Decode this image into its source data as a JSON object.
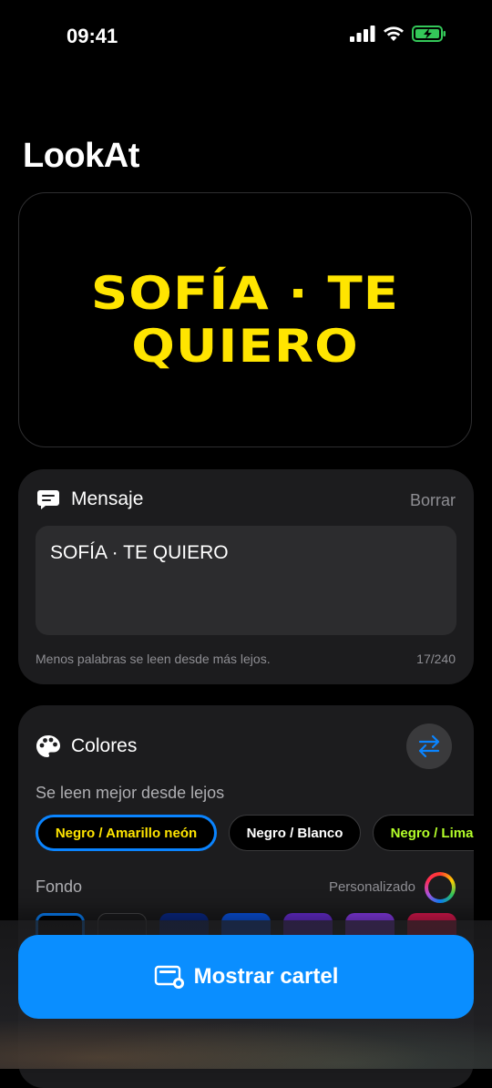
{
  "status_bar": {
    "time": "09:41"
  },
  "app": {
    "title": "LookAt"
  },
  "preview": {
    "text": "SOFÍA · TE QUIERO",
    "text_color": "#ffe500",
    "background": "#000000"
  },
  "message_card": {
    "icon": "message-icon",
    "title": "Mensaje",
    "clear_label": "Borrar",
    "value": "SOFÍA · TE QUIERO",
    "hint": "Menos palabras se leen desde más lejos.",
    "counter": "17/240"
  },
  "colors_card": {
    "icon": "palette-icon",
    "title": "Colores",
    "swap_icon": "swap-arrows-icon",
    "subtitle": "Se leen mejor desde lejos",
    "presets": [
      {
        "label": "Negro / Amarillo neón",
        "text_color": "#ffe500",
        "selected": true
      },
      {
        "label": "Negro / Blanco",
        "text_color": "#ffffff",
        "selected": false
      },
      {
        "label": "Negro / Lima",
        "text_color": "#b4ff2a",
        "selected": false
      }
    ],
    "background_label": "Fondo",
    "custom_label": "Personalizado",
    "background_swatches": [
      "#000000",
      "#1c1c1e",
      "#0a2a8a",
      "#0a55e8",
      "#6a2ed8",
      "#8a3cf0",
      "#e01850"
    ],
    "selected_swatch": 0
  },
  "primary_action": {
    "label": "Mostrar cartel",
    "icon": "display-icon",
    "color": "#0a8eff"
  }
}
